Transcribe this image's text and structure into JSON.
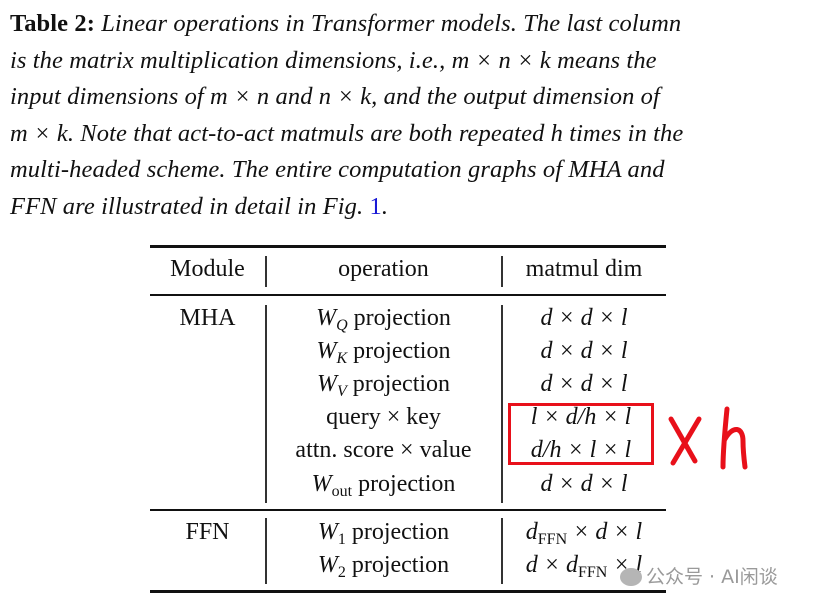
{
  "caption": {
    "label": "Table 2:",
    "l1": " Linear operations in Transformer models. The last column",
    "l2": "is the matrix multiplication dimensions, i.e., m × n × k  means the",
    "l3": "input dimensions of m × n and n × k, and the output dimension of",
    "l4": "m × k. Note that act-to-act matmuls are both repeated h times in the",
    "l5": "multi-headed scheme. The entire computation graphs of MHA and",
    "l6a": "FFN are illustrated in detail in Fig. ",
    "ref": "1",
    "l6b": "."
  },
  "table": {
    "headers": [
      "Module",
      "operation",
      "matmul dim"
    ],
    "groups": [
      {
        "module": "MHA",
        "rows": [
          {
            "op_var": "W",
            "op_sub": "Q",
            "op_text": " projection",
            "dim": "d × d × l"
          },
          {
            "op_var": "W",
            "op_sub": "K",
            "op_text": " projection",
            "dim": "d × d × l"
          },
          {
            "op_var": "W",
            "op_sub": "V",
            "op_text": " projection",
            "dim": "d × d × l"
          },
          {
            "op_var": "",
            "op_sub": "",
            "op_text": "query × key",
            "dim": "l × d/h × l"
          },
          {
            "op_var": "",
            "op_sub": "",
            "op_text": "attn. score × value",
            "dim": "d/h × l × l"
          },
          {
            "op_var": "W",
            "op_sub": "out",
            "op_text": " projection",
            "dim": "d × d × l"
          }
        ]
      },
      {
        "module": "FFN",
        "rows": [
          {
            "op_var": "W",
            "op_sub": "1",
            "op_text": " projection",
            "dim_a": "d",
            "dim_sub": "FFN",
            "dim_b": " × d × l"
          },
          {
            "op_var": "W",
            "op_sub": "2",
            "op_text": " projection",
            "dim_a": "d × d",
            "dim_sub": "FFN",
            "dim_b": " × l"
          }
        ]
      }
    ]
  },
  "annotation": {
    "text": "× h",
    "color": "#e8101a"
  },
  "watermark": {
    "text": "公众号 · AI闲谈"
  }
}
